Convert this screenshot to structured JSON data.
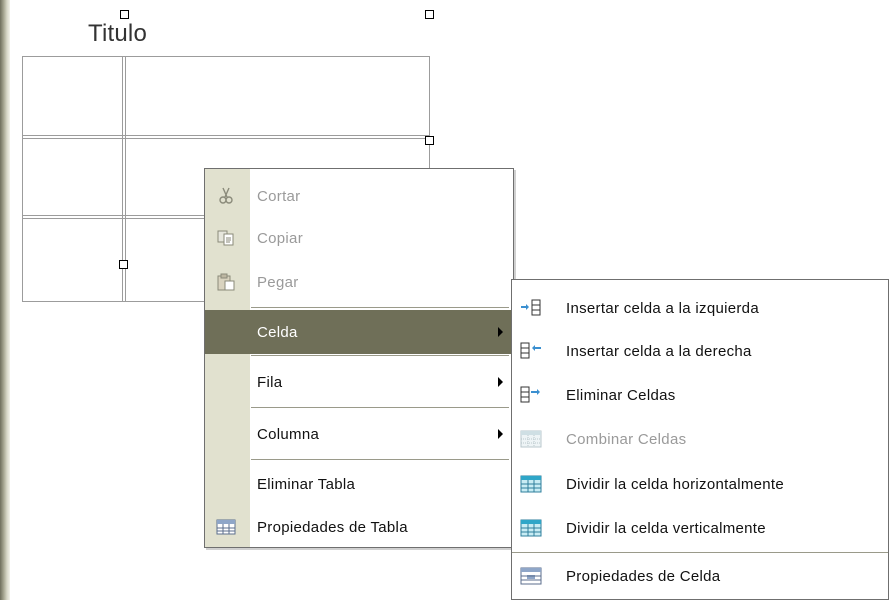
{
  "document": {
    "title": "Titulo"
  },
  "context_menu": {
    "items": [
      {
        "label": "Cortar",
        "icon": "scissors-icon",
        "disabled": true
      },
      {
        "label": "Copiar",
        "icon": "copy-icon",
        "disabled": true
      },
      {
        "label": "Pegar",
        "icon": "paste-icon",
        "disabled": true
      },
      {
        "label": "Celda",
        "submenu": true,
        "active": true
      },
      {
        "label": "Fila",
        "submenu": true
      },
      {
        "label": "Columna",
        "submenu": true
      },
      {
        "label": "Eliminar Tabla"
      },
      {
        "label": "Propiedades de Tabla",
        "icon": "table-properties-icon"
      }
    ]
  },
  "submenu": {
    "items": [
      {
        "label": "Insertar celda a la izquierda",
        "icon": "insert-cell-left-icon"
      },
      {
        "label": "Insertar celda a la derecha",
        "icon": "insert-cell-right-icon"
      },
      {
        "label": "Eliminar Celdas",
        "icon": "delete-cells-icon"
      },
      {
        "label": "Combinar Celdas",
        "icon": "merge-cells-icon",
        "disabled": true
      },
      {
        "label": "Dividir la celda horizontalmente",
        "icon": "split-horizontal-icon"
      },
      {
        "label": "Dividir la celda verticalmente",
        "icon": "split-vertical-icon"
      },
      {
        "label": "Propiedades de Celda",
        "icon": "cell-properties-icon"
      }
    ]
  },
  "colors": {
    "menu_gutter": "#e1e1cf",
    "active_item": "#6f6f58",
    "disabled_text": "#9a9a9a"
  }
}
